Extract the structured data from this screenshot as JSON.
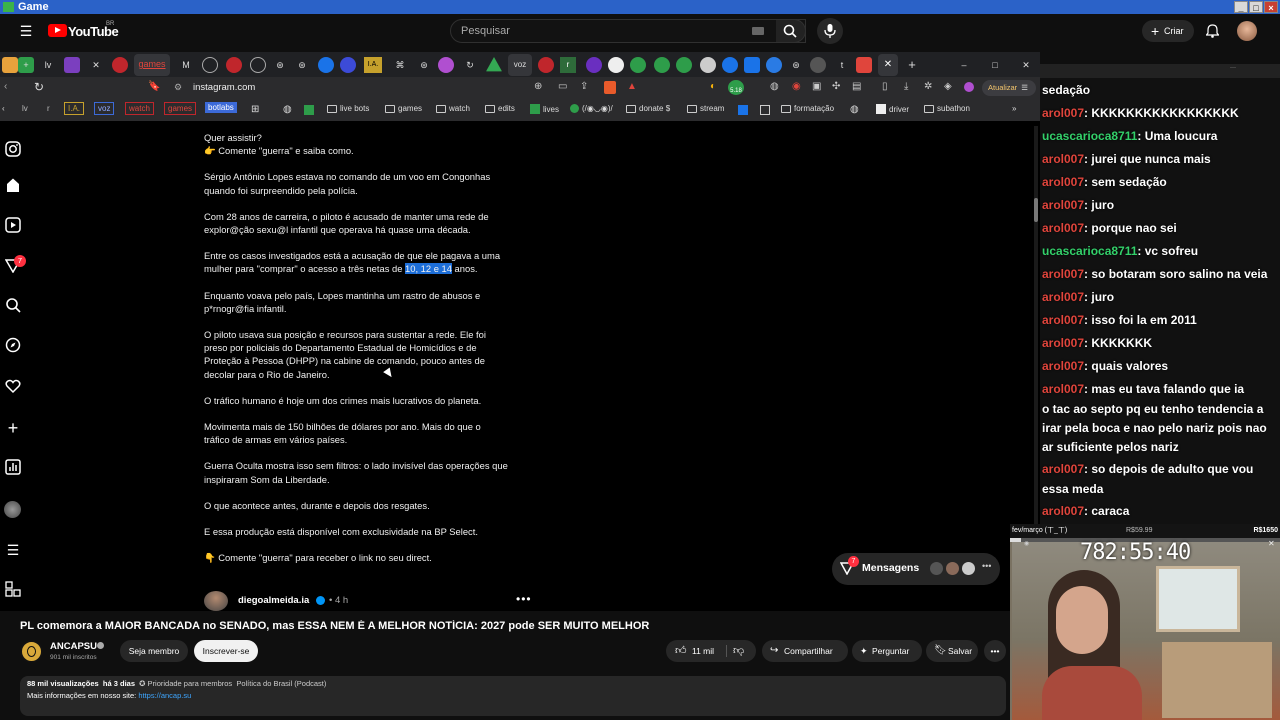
{
  "window": {
    "title": "Game"
  },
  "youtube": {
    "brand": "YouTube",
    "region": "BR",
    "search_placeholder": "Pesquisar",
    "create_label": "Criar",
    "video_title": "PL comemora a MAIOR BANCADA no SENADO, mas ESSA NEM É A MELHOR NOTÍCIA: 2027 pode SER MUITO MELHOR",
    "channel": "ANCAPSU",
    "subscribers": "901 mil inscritos",
    "member_label": "Seja membro",
    "subscribe_label": "Inscrever-se",
    "likes": "11 mil",
    "share_label": "Compartilhar",
    "ask_label": "Perguntar",
    "save_label": "Salvar",
    "views": "88 mil visualizações",
    "age": "há 3 dias",
    "desc_priority": "✪ Prioridade para membros",
    "desc_tag": "Política do Brasil (Podcast)",
    "desc_more": "Mais informações em nosso site:",
    "desc_link": "https://ancap.su"
  },
  "browser": {
    "tabs": [
      "lv",
      "games",
      "I.A.",
      "voz",
      "r"
    ],
    "url": "instagram.com",
    "update_label": "Atualizar",
    "ext_badge": "5.18",
    "bookmarks": [
      "lv",
      "r",
      "I.A.",
      "voz",
      "watch",
      "games",
      "botlabs",
      "live bots",
      "games",
      "watch",
      "edits",
      "lives",
      "(/◉◡◉)/",
      "donate $",
      "stream",
      "formatação",
      "driver",
      "subathon"
    ]
  },
  "instagram": {
    "notif_count": "7",
    "post_paragraphs": [
      [
        "Quer assistir?",
        "👉 Comente \"guerra\" e saiba como."
      ],
      [
        "Sérgio Antônio Lopes estava no comando de um voo em Congonhas",
        "quando foi surpreendido pela polícia."
      ],
      [
        "Com 28 anos de carreira, o piloto é acusado de manter uma rede de",
        "explor@ção sexu@l infantil que operava há quase uma década."
      ],
      [
        "Entre os casos investigados está a acusação de que ele pagava a uma"
      ],
      [
        "Enquanto voava pelo país, Lopes mantinha um rastro de abusos e",
        "p*rnogr@fia infantil."
      ],
      [
        "O piloto usava sua posição e recursos para sustentar a rede. Ele foi",
        "preso por policiais do Departamento Estadual de Homicídios e de",
        "Proteção à Pessoa (DHPP) na cabine de comando, pouco antes de",
        "decolar para o Rio de Janeiro."
      ],
      [
        "O tráfico humano é hoje um dos crimes mais lucrativos do planeta."
      ],
      [
        "Movimenta mais de 150 bilhões de dólares por ano. Mais do que o",
        "tráfico de armas em vários países."
      ],
      [
        "Guerra Oculta mostra isso sem filtros: o lado invisível das operações que",
        "inspiraram Som da Liberdade."
      ],
      [
        "O que acontece antes, durante e depois dos resgates."
      ],
      [
        "E essa produção está disponível com exclusividade na BP Select."
      ],
      [
        "👇 Comente \"guerra\" para receber o link no seu direct."
      ]
    ],
    "line_a": "mulher para \"comprar\" o acesso a três netas de ",
    "highlight": "10, 12 e 14",
    "line_b": " anos.",
    "author": "diegoalmeida.ia",
    "post_age": "• 4 h",
    "messages_label": "Mensagens",
    "messages_badge": "7"
  },
  "chat": [
    {
      "user": "",
      "text": "sedação",
      "c": "u"
    },
    {
      "user": "arol007",
      "text": ": KKKKKKKKKKKKKKKKK",
      "c": "u"
    },
    {
      "user": "ucascarioca8711",
      "text": ": Uma loucura",
      "c": "g"
    },
    {
      "user": "arol007",
      "text": ": jurei que nunca mais",
      "c": "u"
    },
    {
      "user": "arol007",
      "text": ": sem sedação",
      "c": "u"
    },
    {
      "user": "arol007",
      "text": ": juro",
      "c": "u"
    },
    {
      "user": "arol007",
      "text": ": porque nao sei",
      "c": "u"
    },
    {
      "user": "ucascarioca8711",
      "text": ": vc sofreu",
      "c": "g"
    },
    {
      "user": "arol007",
      "text": ": so botaram soro salino na veia",
      "c": "u"
    },
    {
      "user": "arol007",
      "text": ": juro",
      "c": "u"
    },
    {
      "user": "arol007",
      "text": ": isso foi la em 2011",
      "c": "u"
    },
    {
      "user": "arol007",
      "text": ": KKKKKKK",
      "c": "u"
    },
    {
      "user": "arol007",
      "text": ": quais valores",
      "c": "u"
    },
    {
      "user": "arol007",
      "text": ": mas eu tava falando que ia",
      "c": "u"
    },
    {
      "user": "",
      "text": "o tac ao septo pq eu tenho tendencia a",
      "c": "u"
    },
    {
      "user": "",
      "text": "irar pela boca e nao pelo nariz pois nao",
      "c": "u"
    },
    {
      "user": "",
      "text": "ar suficiente pelos nariz",
      "c": "u"
    },
    {
      "user": "arol007",
      "text": ": so depois de adulto que vou",
      "c": "u"
    },
    {
      "user": "",
      "text": "essa meda",
      "c": "u"
    },
    {
      "user": "arol007",
      "text": ": caraca",
      "c": "u"
    }
  ],
  "overlay": {
    "goal_left": "fev/março (ㄒ_ㄒ)",
    "goal_mid": "R$59.99",
    "goal_right": "R$1650",
    "timer": "782:55:40"
  },
  "colors": {
    "yt_red": "#ff0000",
    "chat_user": "#e0453c",
    "chat_user_alt": "#33d06a",
    "ig_highlight": "#1d6ed8"
  }
}
